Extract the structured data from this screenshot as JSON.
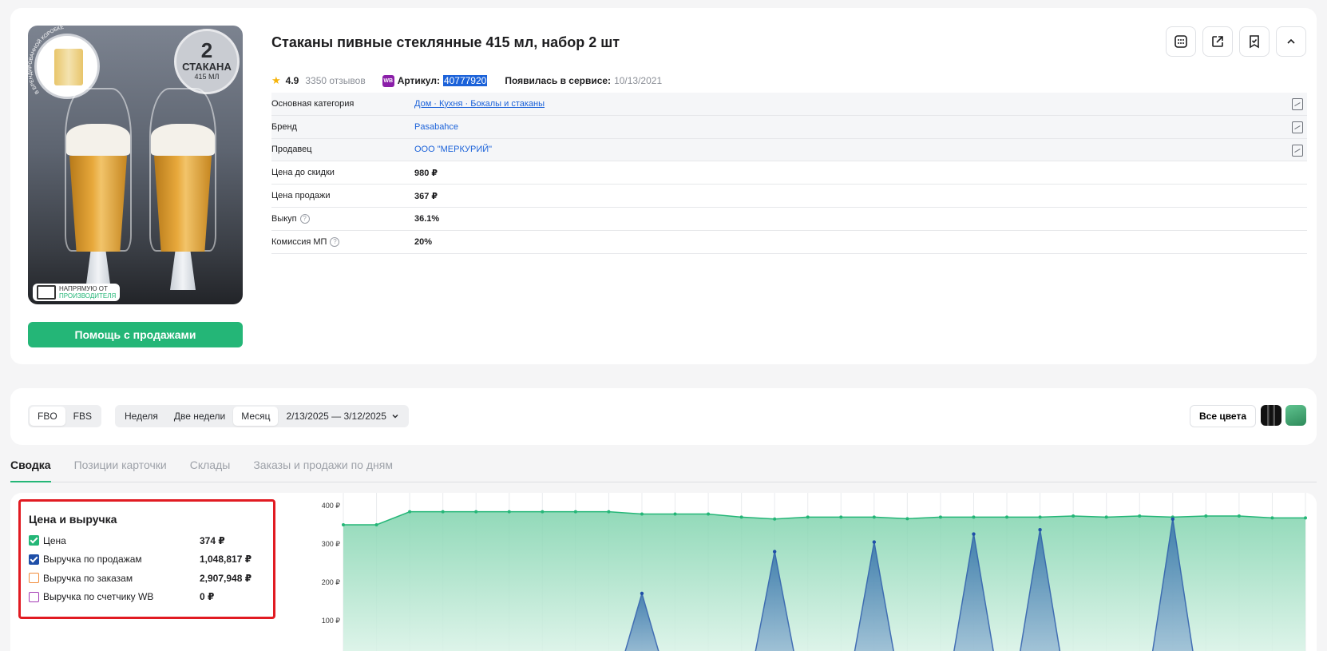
{
  "product": {
    "title": "Стаканы пивные стеклянные 415 мл, набор 2 шт",
    "rating": "4.9",
    "reviews": "3350 отзывов",
    "wb_badge": "WB",
    "article_label": "Артикул:",
    "article_value": "40777920",
    "since_label": "Появилась в сервисе:",
    "since_value": "10/13/2021",
    "image": {
      "badge_num": "2",
      "badge_word": "СТАКАНА",
      "badge_volume": "415 МЛ",
      "arc_text": "В БРЕНДИРОВАННОЙ КОРОБКЕ",
      "maker_line1": "НАПРЯМУЮ ОТ",
      "maker_line2": "ПРОИЗВОДИТЕЛЯ"
    },
    "help_button": "Помощь с продажами"
  },
  "specs": [
    {
      "key": "Основная категория",
      "value": "Дом · Кухня · Бокалы и стаканы",
      "style": "link-u",
      "bookmark": true,
      "help": false
    },
    {
      "key": "Бренд",
      "value": "Pasabahce",
      "style": "link",
      "bookmark": true,
      "help": false
    },
    {
      "key": "Продавец",
      "value": "ООО \"МЕРКУРИЙ\"",
      "style": "link",
      "bookmark": true,
      "help": false
    },
    {
      "key": "Цена до скидки",
      "value": "980 ₽",
      "style": "bold",
      "bookmark": false,
      "help": false
    },
    {
      "key": "Цена продажи",
      "value": "367 ₽",
      "style": "bold",
      "bookmark": false,
      "help": false
    },
    {
      "key": "Выкуп",
      "value": "36.1%",
      "style": "bold",
      "bookmark": false,
      "help": true
    },
    {
      "key": "Комиссия МП",
      "value": "20%",
      "style": "bold",
      "bookmark": false,
      "help": true
    }
  ],
  "actions": [
    "calculator-icon",
    "external-link-icon",
    "bookmark-check-icon",
    "chevron-up-icon"
  ],
  "filters": {
    "fulfillment": [
      "FBO",
      "FBS"
    ],
    "fulfillment_active": 0,
    "periods": [
      "Неделя",
      "Две недели",
      "Месяц"
    ],
    "period_active": 2,
    "date_range": "2/13/2025 — 3/12/2025",
    "all_colors": "Все цвета"
  },
  "tabs": [
    "Сводка",
    "Позиции карточки",
    "Склады",
    "Заказы и продажи по дням"
  ],
  "tab_active": 0,
  "legend": {
    "title": "Цена и выручка",
    "items": [
      {
        "name": "Цена",
        "value": "374 ₽",
        "checked": true,
        "color": "#24b677"
      },
      {
        "name": "Выручка по продажам",
        "value": "1,048,817 ₽",
        "checked": true,
        "color": "#1f4fa8"
      },
      {
        "name": "Выручка по заказам",
        "value": "2,907,948 ₽",
        "checked": false,
        "color": "#f28c3a"
      },
      {
        "name": "Выручка по счетчику WB",
        "value": "0 ₽",
        "checked": false,
        "color": "#a43bb5"
      }
    ]
  },
  "chart_data": {
    "type": "area",
    "ylabel": "",
    "y_ticks": [
      "400 ₽",
      "300 ₽",
      "200 ₽",
      "100 ₽"
    ],
    "y_tick_values": [
      400,
      300,
      200,
      100
    ],
    "ylim": [
      0,
      420
    ],
    "series": [
      {
        "name": "Цена",
        "color": "#24b677",
        "values": [
          350,
          350,
          384,
          384,
          384,
          384,
          384,
          384,
          384,
          378,
          378,
          378,
          370,
          365,
          370,
          370,
          370,
          366,
          370,
          370,
          370,
          370,
          373,
          370,
          373,
          370,
          373,
          373,
          368,
          368
        ]
      },
      {
        "name": "Выручка по продажам",
        "color": "#1f4fa8",
        "values": [
          0,
          0,
          0,
          0,
          0,
          0,
          0,
          0,
          0,
          171,
          0,
          0,
          0,
          280,
          0,
          0,
          305,
          0,
          0,
          326,
          0,
          337,
          0,
          0,
          0,
          365,
          0,
          0,
          0,
          0
        ]
      }
    ]
  }
}
